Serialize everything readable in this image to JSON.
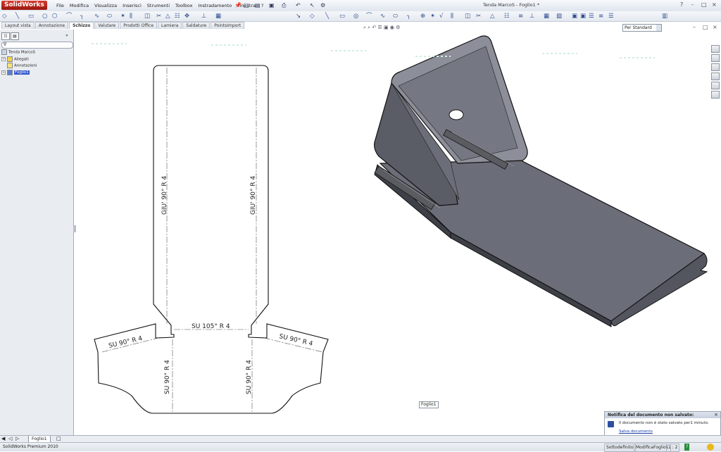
{
  "app": {
    "logo": "SolidWorks",
    "window_title": "Tenda MarcoS - Foglio1 *",
    "menu": [
      "File",
      "Modifica",
      "Visualizza",
      "Inserisci",
      "Strumenti",
      "Toolbox",
      "Instradamento",
      "Finestra",
      "?"
    ],
    "window_controls": [
      "?",
      "-",
      "_",
      "□",
      "×"
    ]
  },
  "command_tabs": [
    "Layout vista",
    "Annotazione",
    "Schizzo",
    "Valutare",
    "Prodotti Office",
    "Lamiera",
    "Saldature",
    "PointsImport"
  ],
  "active_tab": "Schizzo",
  "standard_select": "Per Standard",
  "feature_tree": {
    "filter_icon": "∇",
    "items": [
      {
        "label": "Tenda MarcoS",
        "icon": "drawing-icon"
      },
      {
        "label": "Allegati",
        "icon": "attachment-icon"
      },
      {
        "label": "Annotazioni",
        "icon": "annotation-icon"
      },
      {
        "label": "Foglio1",
        "icon": "sheet-icon",
        "selected": true
      }
    ]
  },
  "drawing": {
    "bend_notes": {
      "left_vertical": "GIU' 90° R 4",
      "right_vertical": "GIU' 90° R 4",
      "center_horizontal": "SU 105° R 4",
      "left_tab": "SU 90° R 4",
      "right_tab": "SU 90° R 4",
      "bottom_left": "SU 90° R 4",
      "bottom_right": "SU 90° R 4"
    },
    "sheet_label": "Foglio1"
  },
  "notification": {
    "title": "Notifica del documento non salvato:",
    "message": "Il documento non è stato salvato per1 minuto.",
    "link": "Salva documento",
    "close": "×"
  },
  "sheet_tab": "Foglio1",
  "status": {
    "product": "SolidWorks Premium 2010",
    "state": "Sottodefinito",
    "mode": "ModificaFoglio1",
    "scale": "1 : 2",
    "help": "?"
  },
  "colors": {
    "part_gray": "#62646f",
    "accent_red": "#c22a1e",
    "panel_bg": "#e9ecf1"
  }
}
